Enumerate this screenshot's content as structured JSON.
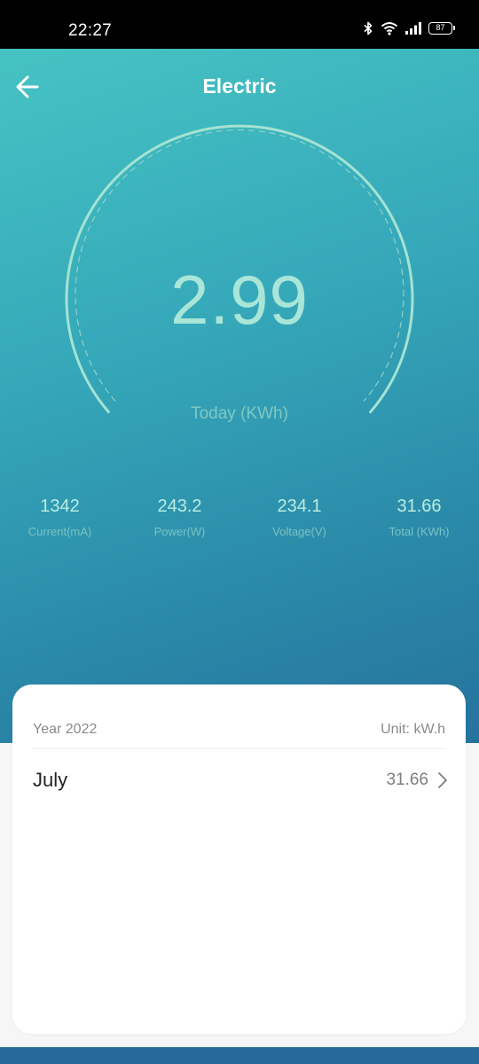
{
  "status_bar": {
    "time": "22:27",
    "battery": "87",
    "icons": [
      "bluetooth-icon",
      "wifi-icon",
      "signal-icon",
      "battery-icon"
    ]
  },
  "header": {
    "title": "Electric",
    "back_icon": "arrow-left-icon"
  },
  "gauge": {
    "value": "2.99",
    "caption": "Today (KWh)"
  },
  "stats": [
    {
      "value": "1342",
      "label": "Current(mA)"
    },
    {
      "value": "243.2",
      "label": "Power(W)"
    },
    {
      "value": "234.1",
      "label": "Voltage(V)"
    },
    {
      "value": "31.66",
      "label": "Total (KWh)"
    }
  ],
  "card": {
    "year_label": "Year 2022",
    "unit_label": "Unit: kW.h",
    "rows": [
      {
        "month": "July",
        "value": "31.66",
        "icon": "chevron-right-icon"
      }
    ]
  },
  "colors": {
    "gradient_start": "#46c3c3",
    "gradient_end": "#25739d",
    "gauge_text": "#a9e6d8",
    "card_background": "#ffffff"
  }
}
